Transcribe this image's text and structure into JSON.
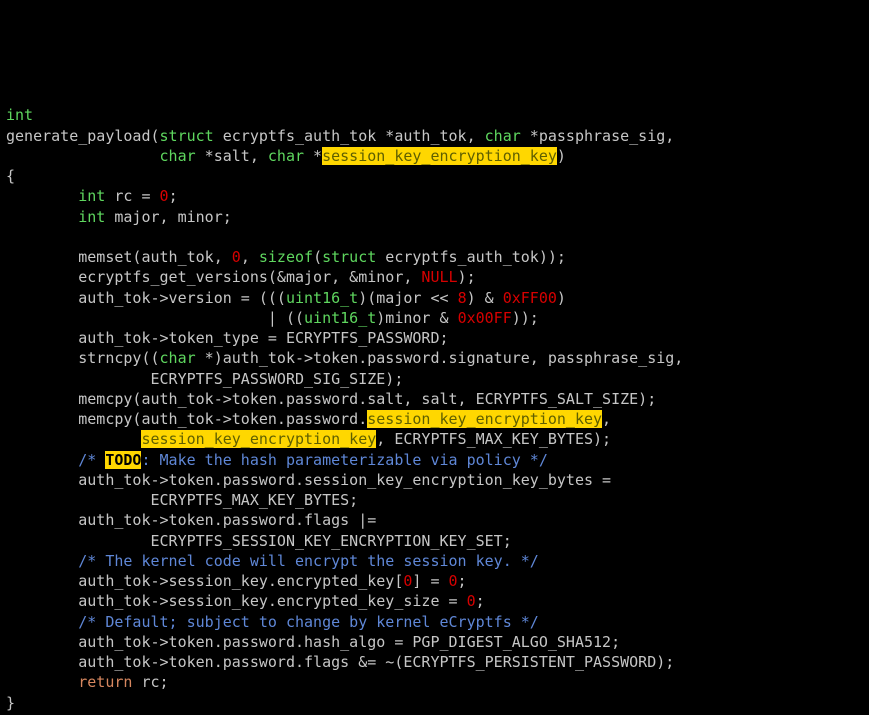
{
  "code": {
    "l1_type": "int",
    "l2_fn": "generate_payload(",
    "l2_struct": "struct",
    "l2_rest1": " ecryptfs_auth_tok *auth_tok, ",
    "l2_char1": "char",
    "l2_rest2": " *passphrase_sig,",
    "l3_pad": "                 ",
    "l3_char1": "char",
    "l3_mid": " *salt, ",
    "l3_char2": "char",
    "l3_star": " *",
    "l3_hl": "session_key_encryption_key",
    "l3_close": ")",
    "l4": "{",
    "l5_pad": "        ",
    "l5_int": "int",
    "l5_rest": " rc = ",
    "l5_zero": "0",
    "l5_semi": ";",
    "l6_pad": "        ",
    "l6_int": "int",
    "l6_rest": " major, minor;",
    "l7": "",
    "l8_pad": "        ",
    "l8_a": "memset(auth_tok, ",
    "l8_zero": "0",
    "l8_b": ", ",
    "l8_sizeof": "sizeof",
    "l8_c": "(",
    "l8_struct": "struct",
    "l8_d": " ecryptfs_auth_tok));",
    "l9_pad": "        ",
    "l9_a": "ecryptfs_get_versions(&major, &minor, ",
    "l9_null": "NULL",
    "l9_b": ");",
    "l10_pad": "        ",
    "l10_a": "auth_tok->version = (((",
    "l10_u16": "uint16_t",
    "l10_b": ")(major << ",
    "l10_8": "8",
    "l10_c": ") & ",
    "l10_ff00": "0xFF00",
    "l10_d": ")",
    "l11_pad": "                             ",
    "l11_a": "| ((",
    "l11_u16": "uint16_t",
    "l11_b": ")minor & ",
    "l11_00ff": "0x00FF",
    "l11_c": "));",
    "l12_pad": "        ",
    "l12": "auth_tok->token_type = ECRYPTFS_PASSWORD;",
    "l13_pad": "        ",
    "l13_a": "strncpy((",
    "l13_char": "char",
    "l13_b": " *)auth_tok->token.password.signature, passphrase_sig,",
    "l14_pad": "                ",
    "l14": "ECRYPTFS_PASSWORD_SIG_SIZE);",
    "l15_pad": "        ",
    "l15": "memcpy(auth_tok->token.password.salt, salt, ECRYPTFS_SALT_SIZE);",
    "l16_pad": "        ",
    "l16_a": "memcpy(auth_tok->token.password.",
    "l16_hl": "session_key_encryption_key",
    "l16_b": ",",
    "l17_pad": "               ",
    "l17_hl": "session_key_encryption_key",
    "l17_b": ", ECRYPTFS_MAX_KEY_BYTES);",
    "l18_pad": "        ",
    "l18_a": "/* ",
    "l18_todo": "TODO",
    "l18_b": ": Make the hash parameterizable via policy */",
    "l19_pad": "        ",
    "l19": "auth_tok->token.password.session_key_encryption_key_bytes =",
    "l20_pad": "                ",
    "l20": "ECRYPTFS_MAX_KEY_BYTES;",
    "l21_pad": "        ",
    "l21": "auth_tok->token.password.flags |=",
    "l22_pad": "                ",
    "l22": "ECRYPTFS_SESSION_KEY_ENCRYPTION_KEY_SET;",
    "l23_pad": "        ",
    "l23": "/* The kernel code will encrypt the session key. */",
    "l24_pad": "        ",
    "l24_a": "auth_tok->session_key.encrypted_key[",
    "l24_zero1": "0",
    "l24_b": "] = ",
    "l24_zero2": "0",
    "l24_c": ";",
    "l25_pad": "        ",
    "l25_a": "auth_tok->session_key.encrypted_key_size = ",
    "l25_zero": "0",
    "l25_b": ";",
    "l26_pad": "        ",
    "l26": "/* Default; subject to change by kernel eCryptfs */",
    "l27_pad": "        ",
    "l27": "auth_tok->token.password.hash_algo = PGP_DIGEST_ALGO_SHA512;",
    "l28_pad": "        ",
    "l28": "auth_tok->token.password.flags &= ~(ECRYPTFS_PERSISTENT_PASSWORD);",
    "l29_pad": "        ",
    "l29_ret": "return",
    "l29_b": " rc;",
    "l30": "}"
  }
}
